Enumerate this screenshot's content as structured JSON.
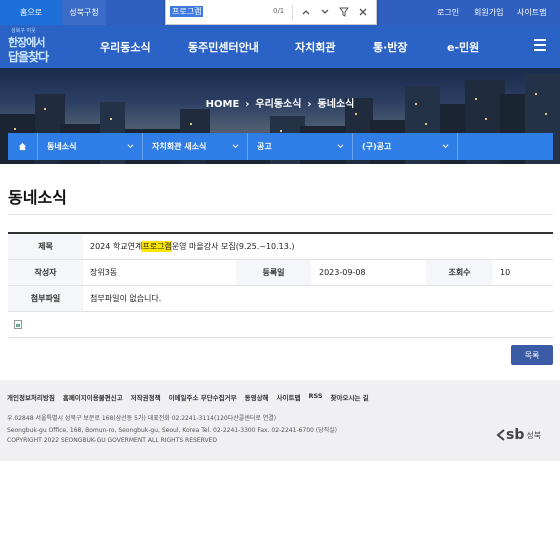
{
  "topbar": {
    "home_tab": "홈으로",
    "site_tab": "성북구청",
    "login": "로그인",
    "join": "회원가입",
    "sitemap": "사이트맵"
  },
  "findbar": {
    "query": "프로그램",
    "count": "0/1"
  },
  "header": {
    "logo_line1": "성북구 이웃",
    "logo_line2": "한장에서",
    "logo_line3": "답을찾다",
    "nav": [
      "우리동소식",
      "동주민센터안내",
      "자치회관",
      "통·반장",
      "e-민원"
    ]
  },
  "breadcrumb": [
    "HOME",
    "우리동소식",
    "동네소식"
  ],
  "subnav": [
    "동네소식",
    "자치회관 새소식",
    "공고",
    "(구)공고"
  ],
  "page_title": "동네소식",
  "post": {
    "title_label": "제목",
    "title_before": "2024 학교연계 ",
    "title_highlight": "프로그램",
    "title_after": " 운영 마을강사 모집(9.25.~10.13.)",
    "author_label": "작성자",
    "author": "장위3동",
    "date_label": "등록일",
    "date": "2023-09-08",
    "views_label": "조회수",
    "views": "10",
    "attach_label": "첨부파일",
    "attach": "첨부파일이 없습니다."
  },
  "list_button": "목록",
  "footer": {
    "links": [
      "개인정보처리방침",
      "홈페이지이용불편신고",
      "저작권정책",
      "이메일주소 무단수집거부",
      "동영상해",
      "사이트맵",
      "RSS",
      "찾아오시는 길"
    ],
    "address_kr": "우.02848 서울특별시 성북구 보문로 168(삼선동 5가) 대표전화 02.2241-3114(120다산콜센터로 연결)",
    "address_en": "Seongbuk-gu Office, 168, Bomun-ro, Seongbuk-gu, Seoul, Korea Tel. 02-2241-3300 Fax. 02-2241-6700 (당직실)",
    "copyright": "COPYRIGHT 2022 SEONGBUK-GU GOVERMENT ALL RIGHTS RESERVED",
    "logo_sb": "sb",
    "logo_gu": "성북"
  }
}
